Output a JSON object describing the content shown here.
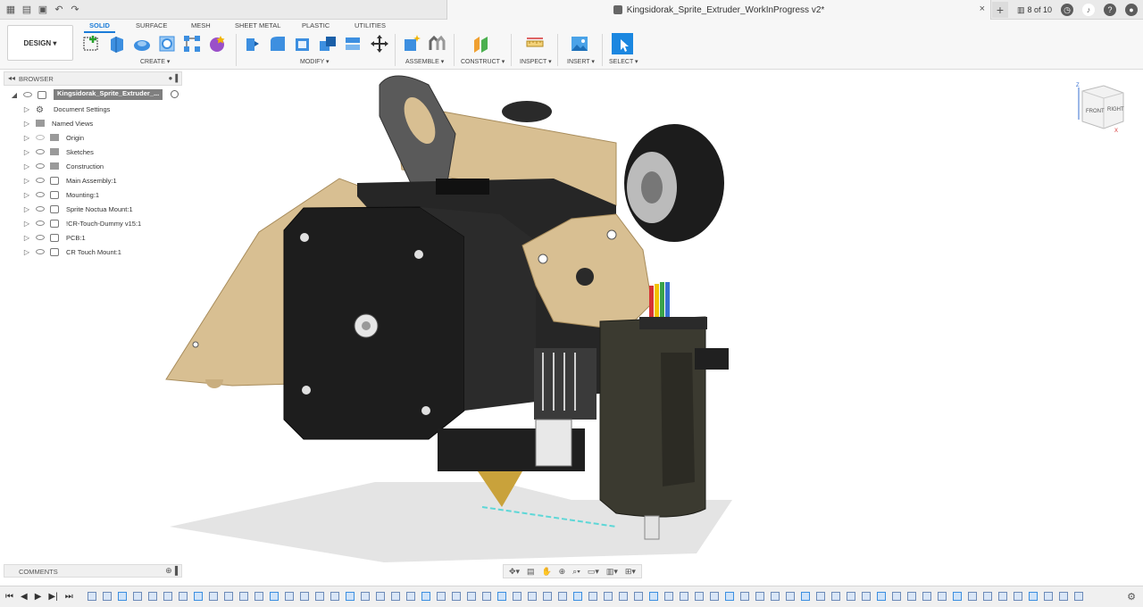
{
  "titlebar": {
    "document_title": "Kingsidorak_Sprite_Extruder_WorkInProgress v2*",
    "pages": "8 of 10"
  },
  "toolbar": {
    "workspace": "DESIGN",
    "tabs": [
      "SOLID",
      "SURFACE",
      "MESH",
      "SHEET METAL",
      "PLASTIC",
      "UTILITIES"
    ],
    "active_tab": "SOLID",
    "groups": [
      "CREATE",
      "MODIFY",
      "ASSEMBLE",
      "CONSTRUCT",
      "INSPECT",
      "INSERT",
      "SELECT"
    ]
  },
  "browser": {
    "title": "BROWSER",
    "root": "Kingsidorak_Sprite_Extruder_...",
    "items": [
      {
        "label": "Document Settings",
        "type": "settings"
      },
      {
        "label": "Named Views",
        "type": "folder"
      },
      {
        "label": "Origin",
        "type": "folder"
      },
      {
        "label": "Sketches",
        "type": "folder"
      },
      {
        "label": "Construction",
        "type": "folder"
      },
      {
        "label": "Main Assembly:1",
        "type": "component"
      },
      {
        "label": "Mounting:1",
        "type": "component"
      },
      {
        "label": "Sprite Noctua Mount:1",
        "type": "component"
      },
      {
        "label": "!CR-Touch-Dummy v15:1",
        "type": "component"
      },
      {
        "label": "PCB:1",
        "type": "component"
      },
      {
        "label": "CR Touch Mount:1",
        "type": "component"
      }
    ]
  },
  "comments": {
    "title": "COMMENTS"
  },
  "viewcube": {
    "front": "FRONT",
    "right": "RIGHT"
  },
  "colors": {
    "accent": "#1b7cd8",
    "beige": "#d8bf92",
    "black": "#1b1b1b",
    "gray": "#5a5a5a"
  }
}
